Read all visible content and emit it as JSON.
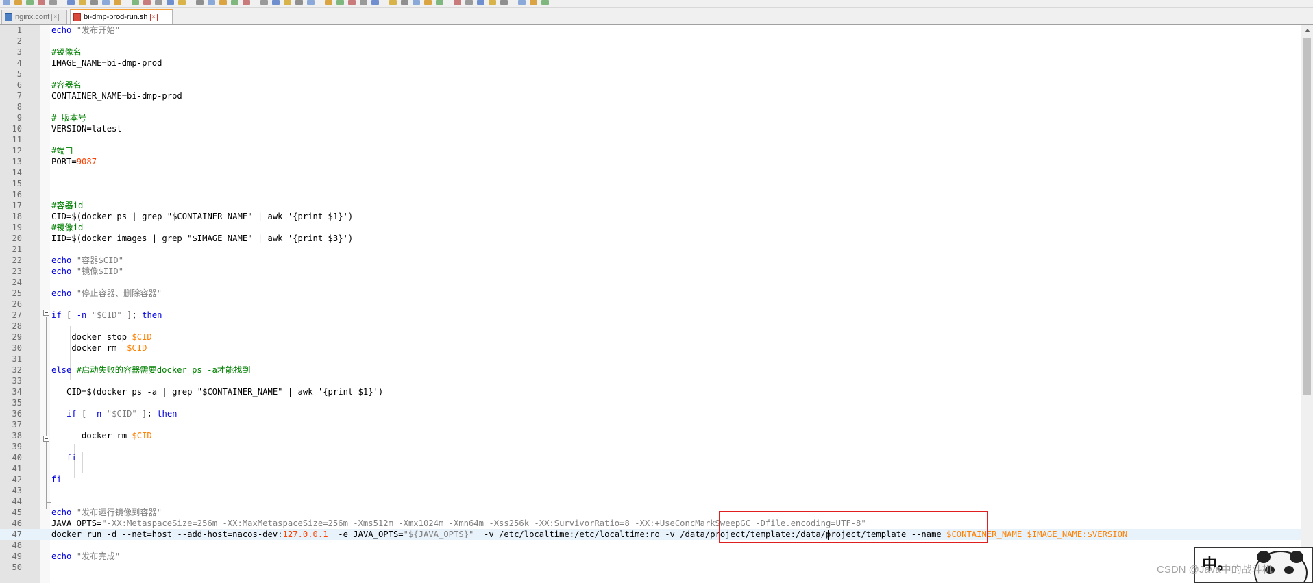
{
  "tabs": [
    {
      "label": "nginx.conf",
      "active": false
    },
    {
      "label": "bi-dmp-prod-run.sh",
      "active": true
    }
  ],
  "lines": [
    {
      "n": "1",
      "t": [
        {
          "c": "kw",
          "s": "echo"
        },
        {
          "s": " "
        },
        {
          "c": "str",
          "s": "\"发布开始\""
        }
      ]
    },
    {
      "n": "2",
      "t": []
    },
    {
      "n": "3",
      "t": [
        {
          "c": "cmt",
          "s": "#镜像名"
        }
      ]
    },
    {
      "n": "4",
      "t": [
        {
          "s": "IMAGE_NAME=bi-dmp-prod"
        }
      ]
    },
    {
      "n": "5",
      "t": []
    },
    {
      "n": "6",
      "t": [
        {
          "c": "cmt",
          "s": "#容器名"
        }
      ]
    },
    {
      "n": "7",
      "t": [
        {
          "s": "CONTAINER_NAME=bi-dmp-prod"
        }
      ]
    },
    {
      "n": "8",
      "t": []
    },
    {
      "n": "9",
      "t": [
        {
          "c": "cmt",
          "s": "# 版本号"
        }
      ]
    },
    {
      "n": "10",
      "t": [
        {
          "s": "VERSION=latest"
        }
      ]
    },
    {
      "n": "11",
      "t": []
    },
    {
      "n": "12",
      "t": [
        {
          "c": "cmt",
          "s": "#端口"
        }
      ]
    },
    {
      "n": "13",
      "t": [
        {
          "s": "PORT="
        },
        {
          "c": "num",
          "s": "9087"
        }
      ]
    },
    {
      "n": "14",
      "t": []
    },
    {
      "n": "15",
      "t": []
    },
    {
      "n": "16",
      "t": []
    },
    {
      "n": "17",
      "t": [
        {
          "c": "cmt",
          "s": "#容器id"
        }
      ]
    },
    {
      "n": "18",
      "t": [
        {
          "s": "CID=$(docker ps | grep \"$CONTAINER_NAME\" | awk '{print $1}')"
        }
      ]
    },
    {
      "n": "19",
      "t": [
        {
          "c": "cmt",
          "s": "#镜像id"
        }
      ]
    },
    {
      "n": "20",
      "t": [
        {
          "s": "IID=$(docker images | grep \"$IMAGE_NAME\" | awk '{print $3}')"
        }
      ]
    },
    {
      "n": "21",
      "t": []
    },
    {
      "n": "22",
      "t": [
        {
          "c": "kw",
          "s": "echo"
        },
        {
          "s": " "
        },
        {
          "c": "str",
          "s": "\"容器$CID\""
        }
      ]
    },
    {
      "n": "23",
      "t": [
        {
          "c": "kw",
          "s": "echo"
        },
        {
          "s": " "
        },
        {
          "c": "str",
          "s": "\"镜像$IID\""
        }
      ]
    },
    {
      "n": "24",
      "t": []
    },
    {
      "n": "25",
      "t": [
        {
          "c": "kw",
          "s": "echo"
        },
        {
          "s": " "
        },
        {
          "c": "str",
          "s": "\"停止容器、删除容器\""
        }
      ]
    },
    {
      "n": "26",
      "t": []
    },
    {
      "n": "27",
      "t": [
        {
          "c": "kw",
          "s": "if"
        },
        {
          "s": " [ "
        },
        {
          "c": "kw",
          "s": "-n"
        },
        {
          "s": " "
        },
        {
          "c": "str",
          "s": "\"$CID\""
        },
        {
          "s": " ]; "
        },
        {
          "c": "kw",
          "s": "then"
        }
      ]
    },
    {
      "n": "28",
      "t": []
    },
    {
      "n": "29",
      "t": [
        {
          "s": "    docker stop "
        },
        {
          "c": "var",
          "s": "$CID"
        }
      ]
    },
    {
      "n": "30",
      "t": [
        {
          "s": "    docker rm  "
        },
        {
          "c": "var",
          "s": "$CID"
        }
      ]
    },
    {
      "n": "31",
      "t": []
    },
    {
      "n": "32",
      "t": [
        {
          "c": "kw",
          "s": "else"
        },
        {
          "s": " "
        },
        {
          "c": "cmt",
          "s": "#启动失败的容器需要docker ps -a才能找到"
        }
      ]
    },
    {
      "n": "33",
      "t": []
    },
    {
      "n": "34",
      "t": [
        {
          "s": "   CID=$(docker ps -a | grep \"$CONTAINER_NAME\" | awk '{print $1}')"
        }
      ]
    },
    {
      "n": "35",
      "t": []
    },
    {
      "n": "36",
      "t": [
        {
          "s": "   "
        },
        {
          "c": "kw",
          "s": "if"
        },
        {
          "s": " [ "
        },
        {
          "c": "kw",
          "s": "-n"
        },
        {
          "s": " "
        },
        {
          "c": "str",
          "s": "\"$CID\""
        },
        {
          "s": " ]; "
        },
        {
          "c": "kw",
          "s": "then"
        }
      ]
    },
    {
      "n": "37",
      "t": []
    },
    {
      "n": "38",
      "t": [
        {
          "s": "      docker rm "
        },
        {
          "c": "var",
          "s": "$CID"
        }
      ]
    },
    {
      "n": "39",
      "t": []
    },
    {
      "n": "40",
      "t": [
        {
          "s": "   "
        },
        {
          "c": "kw",
          "s": "fi"
        }
      ]
    },
    {
      "n": "41",
      "t": []
    },
    {
      "n": "42",
      "t": [
        {
          "c": "kw",
          "s": "fi"
        }
      ]
    },
    {
      "n": "43",
      "t": []
    },
    {
      "n": "44",
      "t": []
    },
    {
      "n": "45",
      "t": [
        {
          "c": "kw",
          "s": "echo"
        },
        {
          "s": " "
        },
        {
          "c": "str",
          "s": "\"发布运行镜像到容器\""
        }
      ]
    },
    {
      "n": "46",
      "t": [
        {
          "s": "JAVA_OPTS="
        },
        {
          "c": "str",
          "s": "\"-XX:MetaspaceSize=256m -XX:MaxMetaspaceSize=256m -Xms512m -Xmx1024m -Xmn64m -Xss256k -XX:SurvivorRatio=8 -XX:+UseConcMarkSweepGC -Dfile.encoding=UTF-8\""
        }
      ]
    },
    {
      "n": "47",
      "t": [
        {
          "s": "docker run -d --net=host --add-host=nacos-dev:"
        },
        {
          "c": "num",
          "s": "127.0.0.1"
        },
        {
          "s": "  -e JAVA_OPTS="
        },
        {
          "c": "str",
          "s": "\"${JAVA_OPTS}\""
        },
        {
          "s": "  -v /etc/localtime:/etc/localtime:ro -v /data/project/template:/data/project/template --name "
        },
        {
          "c": "var",
          "s": "$CONTAINER_NAME $IMAGE_NAME:$VERSION"
        }
      ]
    },
    {
      "n": "48",
      "t": []
    },
    {
      "n": "49",
      "t": [
        {
          "c": "kw",
          "s": "echo"
        },
        {
          "s": " "
        },
        {
          "c": "str",
          "s": "\"发布完成\""
        }
      ]
    },
    {
      "n": "50",
      "t": []
    }
  ],
  "current_line": "47",
  "watermark": "CSDN @Java中的战斗机",
  "sticker_text": "中。",
  "colors": {
    "keyword": "#0000e0",
    "string": "#7f7f7f",
    "comment": "#008000",
    "variable": "#ff8000",
    "number": "#ff4000",
    "highlight_box": "#e02020"
  }
}
